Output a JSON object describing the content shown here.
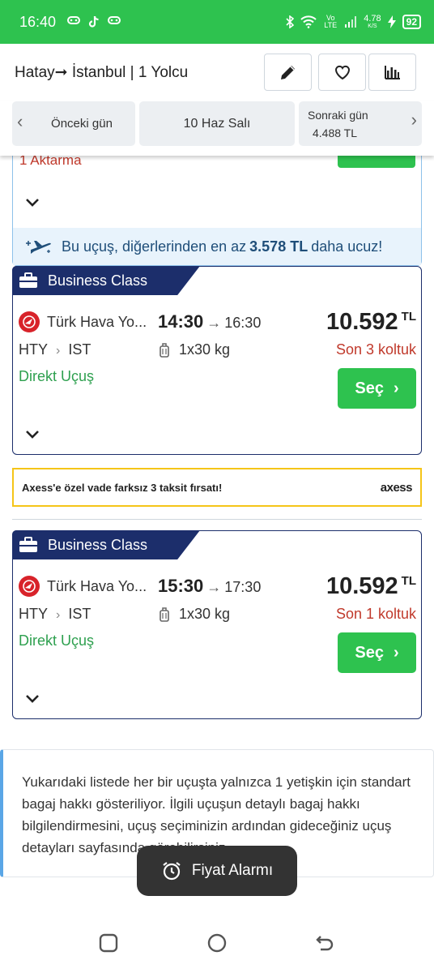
{
  "status": {
    "time": "16:40",
    "net_label": "Vo LTE",
    "speed_value": "4.78",
    "speed_unit": "K/S",
    "battery": "92",
    "icons": [
      "game-controller-icon",
      "tiktok-icon",
      "game-controller-icon",
      "bluetooth-icon",
      "wifi-icon",
      "signal-icon",
      "charging-icon"
    ]
  },
  "header": {
    "from": "Hatay",
    "to": "İstanbul",
    "passengers": "1 Yolcu",
    "buttons": [
      "pencil-icon",
      "heart-icon",
      "bar-chart-icon"
    ]
  },
  "datebar": {
    "prev_label": "Önceki gün",
    "current_label": "10 Haz Salı",
    "next_label": "Sonraki gün",
    "next_price": "4.488 TL"
  },
  "partial_card": {
    "stops": "1 Aktarma",
    "promo_prefix": "Bu uçuş, diğerlerinden en az",
    "promo_amount": "3.578 TL",
    "promo_suffix": "daha ucuz!"
  },
  "flights": [
    {
      "class_label": "Business Class",
      "airline": "Türk Hava Yo...",
      "departure": "14:30",
      "arrival": "16:30",
      "price": "10.592",
      "currency": "TL",
      "origin": "HTY",
      "destination": "IST",
      "baggage": "1x30 kg",
      "seats_left": "Son 3 koltuk",
      "type": "Direkt Uçuş",
      "select_label": "Seç"
    },
    {
      "class_label": "Business Class",
      "airline": "Türk Hava Yo...",
      "departure": "15:30",
      "arrival": "17:30",
      "price": "10.592",
      "currency": "TL",
      "origin": "HTY",
      "destination": "IST",
      "baggage": "1x30 kg",
      "seats_left": "Son 1 koltuk",
      "type": "Direkt Uçuş",
      "select_label": "Seç"
    }
  ],
  "ad": {
    "text": "Axess'e özel vade farksız 3 taksit fırsatı!",
    "brand": "axess"
  },
  "info": {
    "text": "Yukarıdaki listede her bir uçuşta yalnızca 1 yetişkin için standart bagaj hakkı gösteriliyor. İlgili uçuşun detaylı bagaj hakkı bilgilendirmesini, uçuş seçiminizin ardından gideceğiniz uçuş detayları sayfasında görebilirsiniz."
  },
  "fab": {
    "label": "Fiyat Alarmı"
  },
  "colors": {
    "green": "#2ec24f",
    "navy": "#1c2e6b",
    "red": "#c0392b",
    "light_blue": "#e8f3fc"
  }
}
